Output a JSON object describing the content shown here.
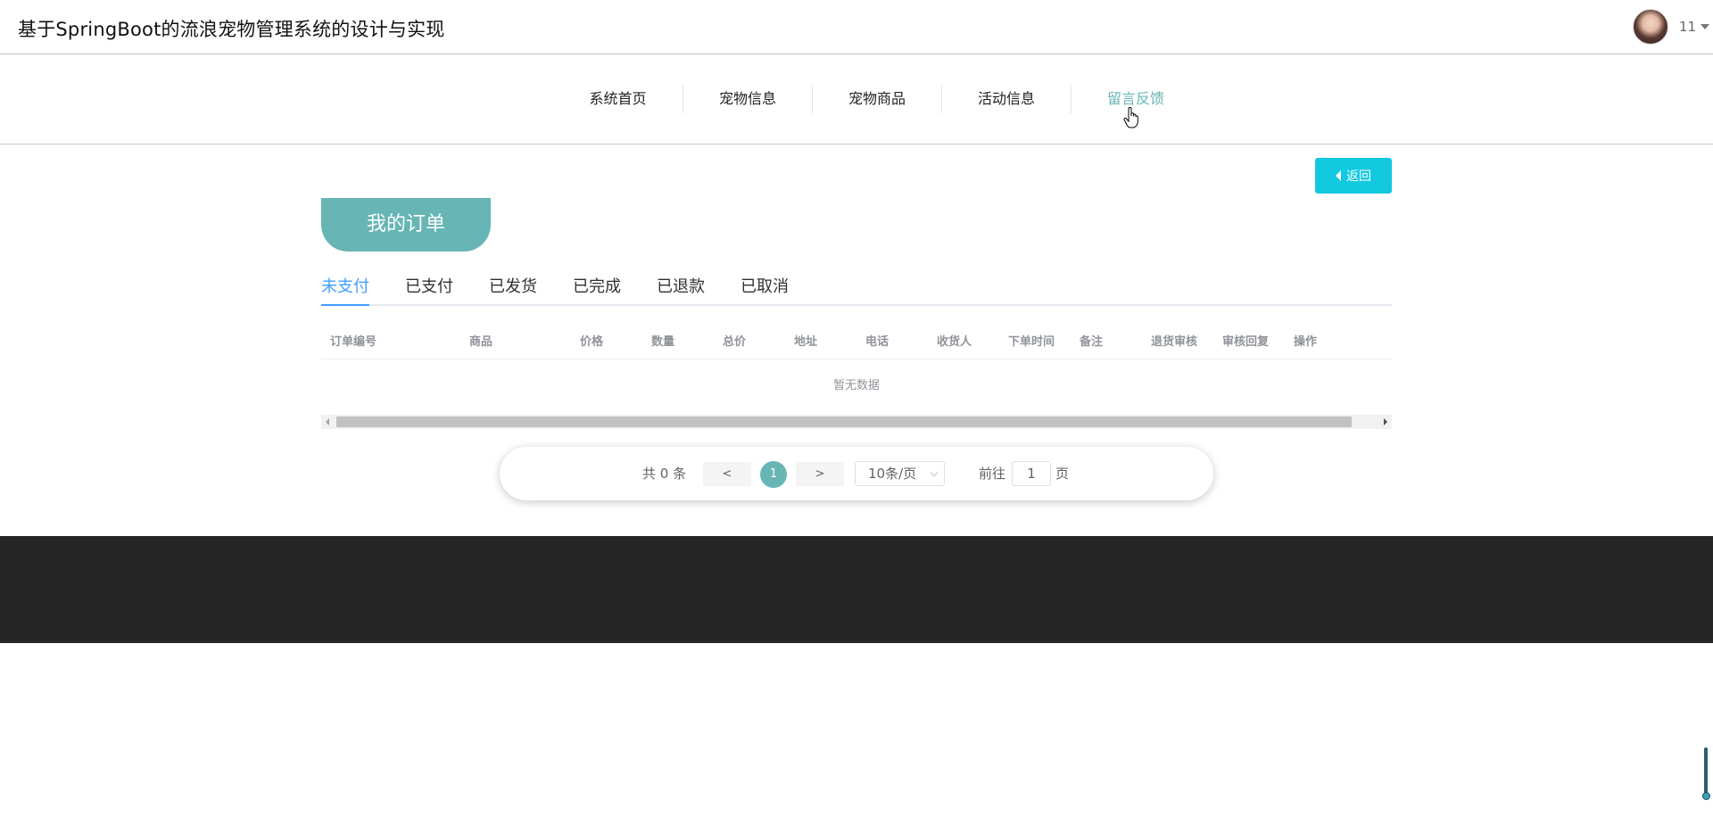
{
  "header": {
    "site_title": "基于SpringBoot的流浪宠物管理系统的设计与实现",
    "username": "11"
  },
  "nav": {
    "items": [
      {
        "label": "系统首页"
      },
      {
        "label": "宠物信息"
      },
      {
        "label": "宠物商品"
      },
      {
        "label": "活动信息"
      },
      {
        "label": "留言反馈"
      }
    ],
    "active_index": 4
  },
  "back_button": {
    "label": "返回"
  },
  "page_title": "我的订单",
  "tabs": {
    "items": [
      {
        "label": "未支付"
      },
      {
        "label": "已支付"
      },
      {
        "label": "已发货"
      },
      {
        "label": "已完成"
      },
      {
        "label": "已退款"
      },
      {
        "label": "已取消"
      }
    ],
    "active_index": 0
  },
  "table": {
    "columns": [
      "订单编号",
      "商品",
      "价格",
      "数量",
      "总价",
      "地址",
      "电话",
      "收货人",
      "下单时间",
      "备注",
      "退货审核",
      "审核回复",
      "操作"
    ],
    "empty_text": "暂无数据"
  },
  "pagination": {
    "total_text": "共 0 条",
    "prev": "<",
    "next": ">",
    "current_page": "1",
    "page_size": "10条/页",
    "goto_label": "前往",
    "goto_value": "1",
    "page_suffix": "页"
  },
  "colors": {
    "accent": "#67b5b5",
    "back_button": "#12c9e0",
    "tab_active": "#409eff",
    "footer": "#262626"
  }
}
